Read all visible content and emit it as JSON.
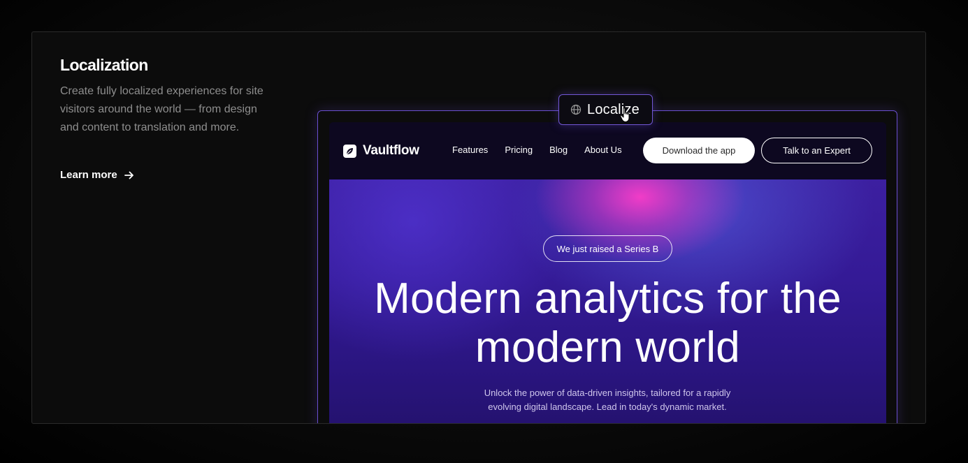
{
  "feature": {
    "title": "Localization",
    "description": "Create fully localized experiences for site visitors around the world — from design and content to translation and more.",
    "learn_more_label": "Learn more",
    "learn_more_icon": "arrow-right-icon"
  },
  "localize_tag": {
    "icon": "globe-icon",
    "label": "Localize"
  },
  "site": {
    "brand": {
      "logo_icon": "vaultflow-logo-icon",
      "name": "Vaultflow"
    },
    "nav": {
      "links": [
        "Features",
        "Pricing",
        "Blog",
        "About Us"
      ],
      "download_label": "Download the app",
      "expert_label": "Talk to an Expert"
    },
    "hero": {
      "badge": "We just raised a Series B",
      "title_line1": "Modern analytics for the",
      "title_line2": "modern world",
      "subtitle_line1": "Unlock the power of data-driven insights, tailored for a rapidly",
      "subtitle_line2": "evolving digital landscape. Lead in today's dynamic market."
    }
  },
  "colors": {
    "accent_border": "#6a4fd0",
    "hero_purple": "#3c1fa0",
    "hero_pink": "#fa3cc8",
    "page_bg": "#0c0c0c"
  }
}
